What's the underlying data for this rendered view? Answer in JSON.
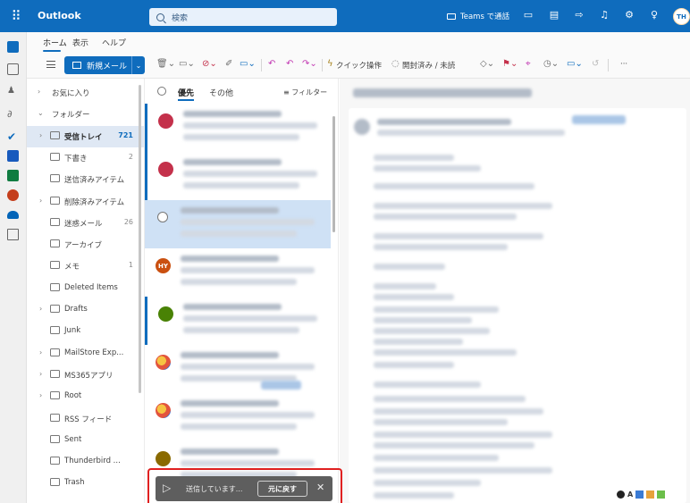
{
  "topbar": {
    "app_name": "Outlook",
    "search_placeholder": "検索",
    "teams_label": "Teams で通話",
    "avatar_initials": "TH"
  },
  "ribbon": {
    "tabs": [
      "ホーム",
      "表示",
      "ヘルプ"
    ],
    "new_mail_label": "新規メール",
    "quick_action_label": "クイック操作",
    "read_unread_label": "開封済み / 未読",
    "more_label": "···"
  },
  "folders": [
    {
      "name": "お気に入り",
      "count": "",
      "level": 0,
      "chevron": ">"
    },
    {
      "name": "フォルダー",
      "count": "",
      "level": 0,
      "chevron": "v"
    },
    {
      "name": "受信トレイ",
      "count": "721",
      "level": 1,
      "chevron": ">",
      "selected": true
    },
    {
      "name": "下書き",
      "count": "2",
      "level": 1,
      "chevron": ""
    },
    {
      "name": "送信済みアイテム",
      "count": "",
      "level": 1,
      "chevron": ""
    },
    {
      "name": "削除済みアイテム",
      "count": "",
      "level": 1,
      "chevron": ">"
    },
    {
      "name": "迷惑メール",
      "count": "26",
      "level": 1,
      "chevron": ""
    },
    {
      "name": "アーカイブ",
      "count": "",
      "level": 1,
      "chevron": ""
    },
    {
      "name": "メモ",
      "count": "1",
      "level": 1,
      "chevron": ""
    },
    {
      "name": "Deleted Items",
      "count": "",
      "level": 1,
      "chevron": ""
    },
    {
      "name": "Drafts",
      "count": "",
      "level": 1,
      "chevron": ">"
    },
    {
      "name": "Junk",
      "count": "",
      "level": 1,
      "chevron": ""
    },
    {
      "name": "MailStore Exp...",
      "count": "",
      "level": 1,
      "chevron": ">"
    },
    {
      "name": "MS365アプリ",
      "count": "",
      "level": 1,
      "chevron": ">"
    },
    {
      "name": "Root",
      "count": "",
      "level": 1,
      "chevron": ">"
    },
    {
      "name": "RSS フィード",
      "count": "",
      "level": 1,
      "chevron": ""
    },
    {
      "name": "Sent",
      "count": "",
      "level": 1,
      "chevron": ""
    },
    {
      "name": "Thunderbird ...",
      "count": "",
      "level": 1,
      "chevron": ""
    },
    {
      "name": "Trash",
      "count": "",
      "level": 1,
      "chevron": ""
    }
  ],
  "message_list": {
    "tab_focused": "優先",
    "tab_other": "その他",
    "filter_label": "フィルター",
    "avatars": [
      {
        "initials": "",
        "color": "#c4314b"
      },
      {
        "initials": "",
        "color": "#c4314b"
      },
      {
        "initials": "",
        "color": ""
      },
      {
        "initials": "HY",
        "color": "#ca5010"
      },
      {
        "initials": "",
        "color": "#498205"
      },
      {
        "initials": "",
        "color": "#e8a33d"
      },
      {
        "initials": "",
        "color": "#e8a33d"
      },
      {
        "initials": "",
        "color": "#8a6a00"
      }
    ]
  },
  "toast": {
    "message": "送信しています...",
    "undo_label": "元に戻す",
    "close_label": "✕"
  },
  "colors": {
    "brand": "#0f6cbd",
    "highlight_border": "#e02020"
  }
}
